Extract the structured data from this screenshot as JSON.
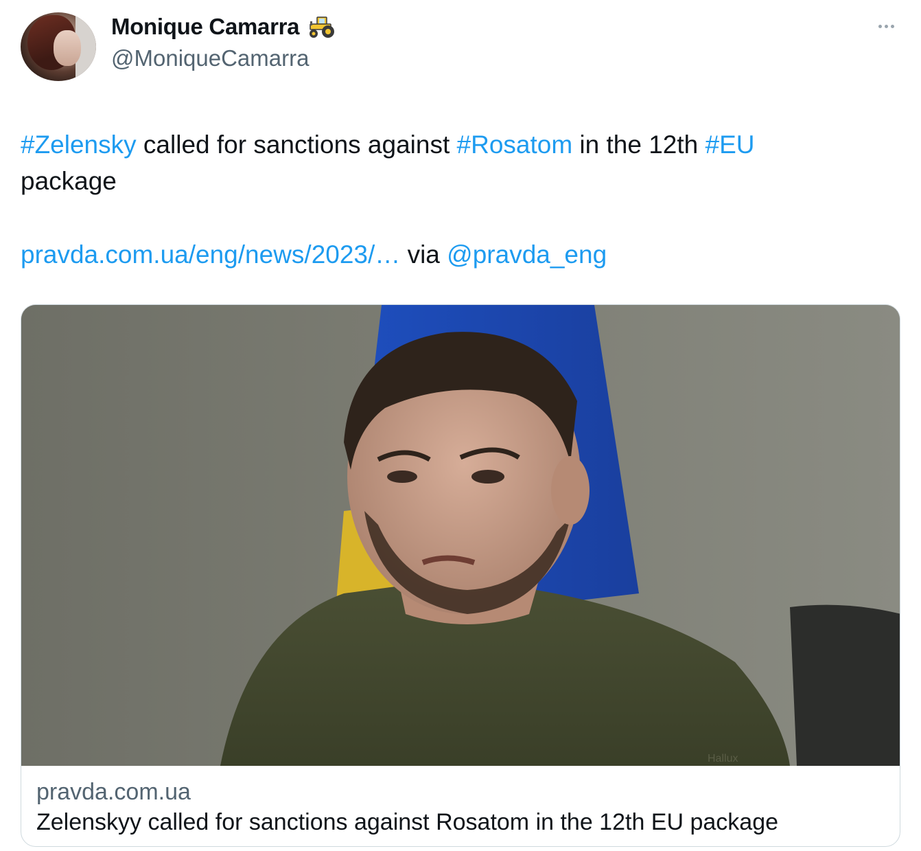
{
  "author": {
    "display_name": "Monique Camarra",
    "handle": "@MoniqueCamarra",
    "badge_icon": "tractor-icon"
  },
  "tweet": {
    "hashtag1": "#Zelensky",
    "text1": " called for sanctions against ",
    "hashtag2": "#Rosatom",
    "text2": " in the 12th ",
    "hashtag3": "#EU",
    "text3": "package",
    "url": "pravda.com.ua/eng/news/2023/…",
    "via": " via ",
    "mention": "@pravda_eng"
  },
  "card": {
    "domain": "pravda.com.ua",
    "title": "Zelenskyy called for sanctions against Rosatom in the 12th EU package",
    "image_watermark": "Hallux"
  },
  "colors": {
    "link": "#1d9bf0",
    "text": "#0f1419",
    "secondary": "#536471",
    "border": "#cfd9de"
  }
}
